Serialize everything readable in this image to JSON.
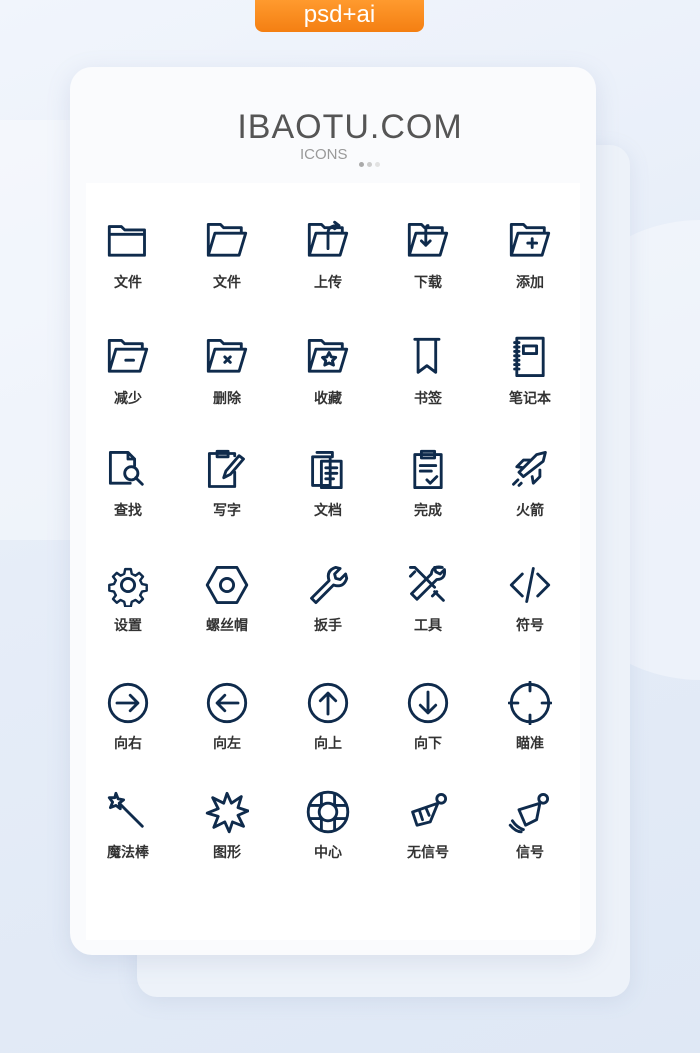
{
  "badge": "psd+ai",
  "header": {
    "title": "IBAOTU.COM",
    "subtitle": "ICONS"
  },
  "colors": {
    "icon": "#0f2b4c",
    "badge": "#f7851a",
    "label": "#333333"
  },
  "icons": [
    {
      "icon": "folder-icon",
      "label": "文件"
    },
    {
      "icon": "folder-open-icon",
      "label": "文件"
    },
    {
      "icon": "folder-upload-icon",
      "label": "上传"
    },
    {
      "icon": "folder-download-icon",
      "label": "下载"
    },
    {
      "icon": "folder-add-icon",
      "label": "添加"
    },
    {
      "icon": "folder-minus-icon",
      "label": "减少"
    },
    {
      "icon": "folder-delete-icon",
      "label": "删除"
    },
    {
      "icon": "folder-star-icon",
      "label": "收藏"
    },
    {
      "icon": "bookmark-icon",
      "label": "书签"
    },
    {
      "icon": "notebook-icon",
      "label": "笔记本"
    },
    {
      "icon": "file-search-icon",
      "label": "查找"
    },
    {
      "icon": "edit-icon",
      "label": "写字"
    },
    {
      "icon": "documents-icon",
      "label": "文档"
    },
    {
      "icon": "clipboard-check-icon",
      "label": "完成"
    },
    {
      "icon": "rocket-icon",
      "label": "火箭"
    },
    {
      "icon": "gear-icon",
      "label": "设置"
    },
    {
      "icon": "hex-nut-icon",
      "label": "螺丝帽"
    },
    {
      "icon": "wrench-icon",
      "label": "扳手"
    },
    {
      "icon": "tools-icon",
      "label": "工具"
    },
    {
      "icon": "code-icon",
      "label": "符号"
    },
    {
      "icon": "arrow-right-circle-icon",
      "label": "向右"
    },
    {
      "icon": "arrow-left-circle-icon",
      "label": "向左"
    },
    {
      "icon": "arrow-up-circle-icon",
      "label": "向上"
    },
    {
      "icon": "arrow-down-circle-icon",
      "label": "向下"
    },
    {
      "icon": "crosshair-icon",
      "label": "瞄准"
    },
    {
      "icon": "magic-wand-icon",
      "label": "魔法棒"
    },
    {
      "icon": "burst-shape-icon",
      "label": "图形"
    },
    {
      "icon": "lifebuoy-icon",
      "label": "中心"
    },
    {
      "icon": "shuttlecock-icon",
      "label": "无信号"
    },
    {
      "icon": "shuttlecock-signal-icon",
      "label": "信号"
    }
  ]
}
